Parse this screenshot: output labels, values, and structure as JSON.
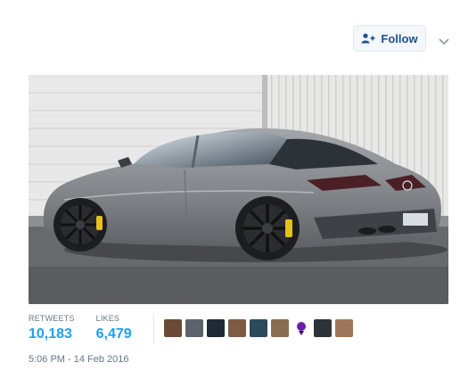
{
  "header": {
    "follow_label": "Follow",
    "follow_icon": "add-user-icon",
    "menu_icon": "chevron-down-icon",
    "accent_color": "#1d4f91"
  },
  "media": {
    "subject": "grey coupe photo"
  },
  "stats": {
    "retweets_label": "RETWEETS",
    "retweets_value": "10,183",
    "likes_label": "LIKES",
    "likes_value": "6,479",
    "value_color": "#1da1f2"
  },
  "likers": {
    "count_shown": 10
  },
  "footer": {
    "timestamp": "5:06 PM - 14 Feb 2016"
  }
}
